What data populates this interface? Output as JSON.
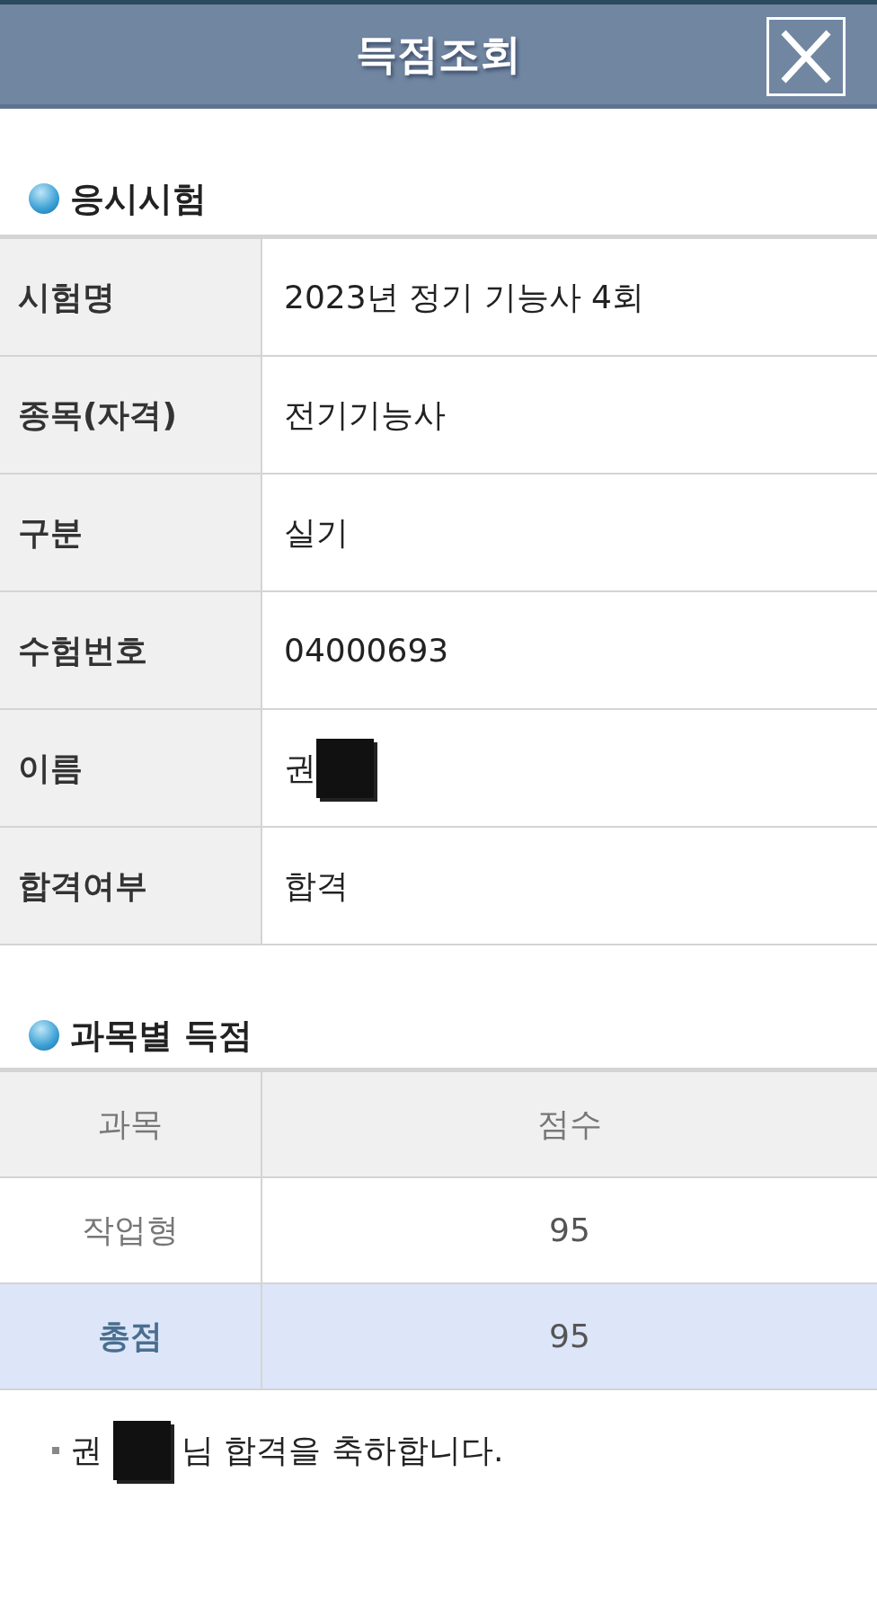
{
  "window": {
    "title": "득점조회"
  },
  "exam_section": {
    "title": "응시시험",
    "rows": [
      {
        "label": "시험명",
        "value": "2023년 정기 기능사 4회"
      },
      {
        "label": "종목(자격)",
        "value": "전기기능사"
      },
      {
        "label": "구분",
        "value": "실기"
      },
      {
        "label": "수험번호",
        "value": "04000693"
      },
      {
        "label": "이름",
        "value": "권",
        "redacted": true
      },
      {
        "label": "합격여부",
        "value": "합격"
      }
    ]
  },
  "score_section": {
    "title": "과목별 득점",
    "columns": [
      "과목",
      "점수"
    ],
    "rows": [
      {
        "subject": "작업형",
        "score": "95",
        "highlighted": false
      },
      {
        "subject": "총점",
        "score": "95",
        "highlighted": true
      }
    ]
  },
  "message": {
    "before": "권",
    "redacted": true,
    "after": "님 합격을 축하합니다."
  }
}
